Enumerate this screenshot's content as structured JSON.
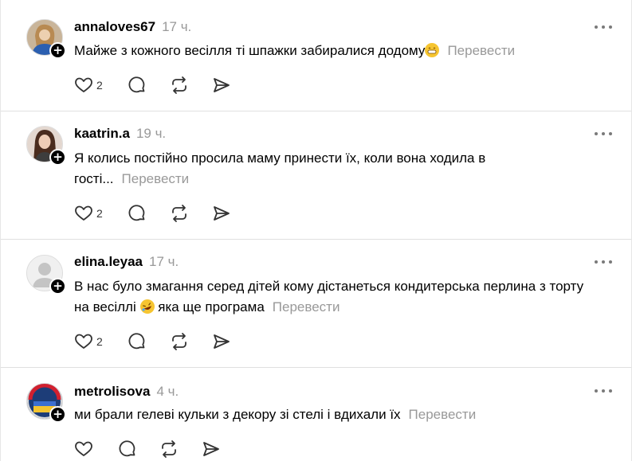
{
  "comments": [
    {
      "username": "annaloves67",
      "time": "17 ч.",
      "text": "Майже з кожного весілля ті шпажки забиралися додому",
      "emoji": "😁",
      "translate": "Перевести",
      "likes": "2",
      "avatar": "photo-woman-blonde"
    },
    {
      "username": "kaatrin.a",
      "time": "19 ч.",
      "text": "Я колись постійно просила маму принести їх, коли вона ходила в гості...",
      "emoji": "",
      "translate": "Перевести",
      "likes": "2",
      "avatar": "photo-woman-brunette"
    },
    {
      "username": "elina.leyaa",
      "time": "17 ч.",
      "text": "В нас було змагання серед дітей кому дістанеться кондитерська перлина з торту на весіллі",
      "emoji": "🤣",
      "text_after": "яка ще програма",
      "translate": "Перевести",
      "likes": "2",
      "avatar": "default-avatar"
    },
    {
      "username": "metrolisova",
      "time": "4 ч.",
      "text": "ми брали гелеві кульки з декору зі стелі і вдихали їх",
      "emoji": "",
      "translate": "Перевести",
      "likes": "",
      "avatar": "badge-logo"
    }
  ],
  "icons": [
    "heart-icon",
    "comment-icon",
    "repost-icon",
    "share-icon",
    "more-icon",
    "follow-plus-icon"
  ],
  "colors": {
    "text": "#000000",
    "muted": "#999999",
    "divider": "#e0e0e0",
    "icon": "#333333"
  }
}
